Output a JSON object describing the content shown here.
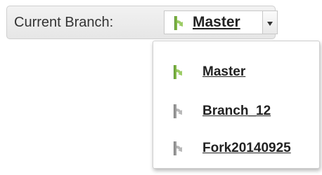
{
  "branch_selector": {
    "label": "Current Branch:",
    "selected": "Master",
    "selected_icon": "branch-icon",
    "toggle_icon": "chevron-down-icon"
  },
  "menu": {
    "items": [
      {
        "label": "Master",
        "icon": "branch-icon",
        "icon_color": "#7cb342"
      },
      {
        "label": "Branch_12",
        "icon": "branch-icon",
        "icon_color": "#9a9a9a"
      },
      {
        "label": "Fork20140925",
        "icon": "branch-icon",
        "icon_color": "#9a9a9a"
      }
    ]
  },
  "colors": {
    "active_branch": "#7cb342",
    "inactive_branch": "#9a9a9a"
  }
}
